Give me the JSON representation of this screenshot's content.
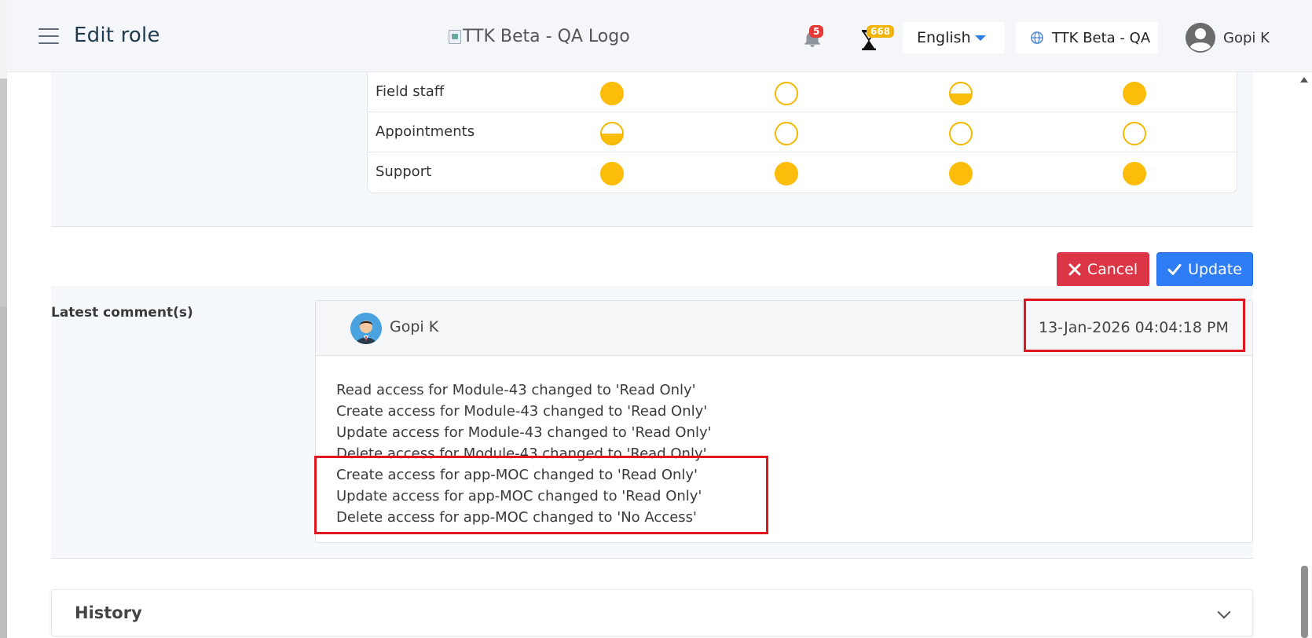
{
  "header": {
    "title": "Edit role",
    "logo_alt": "TTK Beta - QA Logo",
    "notifications_count": "5",
    "pending_count": "668",
    "language": "English",
    "tenant": "TTK Beta - QA",
    "user_name": "Gopi K"
  },
  "permissions": {
    "rows": [
      {
        "label": "Field staff",
        "levels": [
          "full",
          "empty",
          "half",
          "full"
        ]
      },
      {
        "label": "Appointments",
        "levels": [
          "half",
          "empty",
          "empty",
          "empty"
        ]
      },
      {
        "label": "Support",
        "levels": [
          "full",
          "full",
          "full",
          "full"
        ]
      }
    ]
  },
  "actions": {
    "cancel_label": "Cancel",
    "update_label": "Update"
  },
  "comments": {
    "section_label": "Latest comment(s)",
    "author": "Gopi K",
    "date": "13-Jan-2026 04:04:18 PM",
    "lines": [
      "Read access for Module-43 changed to 'Read Only'",
      "Create access for Module-43 changed to 'Read Only'",
      "Update access for Module-43 changed to 'Read Only'",
      "Delete access for Module-43 changed to 'Read Only'",
      "Create access for app-MOC changed to 'Read Only'",
      "Update access for app-MOC changed to 'Read Only'",
      "Delete access for app-MOC changed to 'No Access'"
    ]
  },
  "history": {
    "title": "History"
  },
  "colors": {
    "accent": "#2f7df6",
    "danger": "#dc3545",
    "permission_dot": "#fcbd0a",
    "highlight": "#e0161e"
  }
}
